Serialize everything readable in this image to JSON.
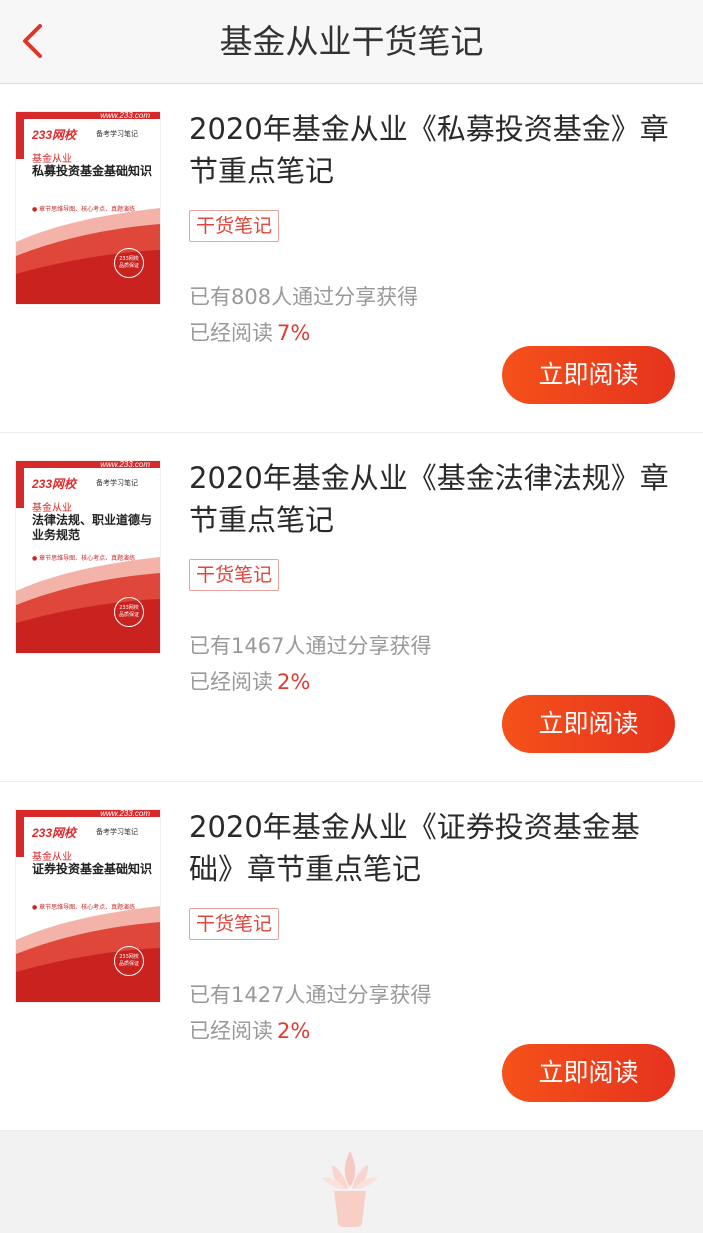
{
  "header": {
    "title": "基金从业干货笔记"
  },
  "colors": {
    "accent": "#e6331e",
    "tag_text": "#e0463b",
    "muted": "#999999"
  },
  "items": [
    {
      "title": "2020年基金从业《私募投资基金》章节重点笔记",
      "tag": "干货笔记",
      "shares": "已有808人通过分享获得",
      "progress_label": "已经阅读",
      "progress": "7%",
      "button": "立即阅读",
      "cover": {
        "url": "www.233.com",
        "brand": "233网校",
        "tagline": "备考学习笔记",
        "subject": "基金从业",
        "book_title": "私募投资基金基础知识",
        "bullets": "● 章节思维导图、核心考点、真题演练"
      }
    },
    {
      "title": "2020年基金从业《基金法律法规》章节重点笔记",
      "tag": "干货笔记",
      "shares": "已有1467人通过分享获得",
      "progress_label": "已经阅读",
      "progress": "2%",
      "button": "立即阅读",
      "cover": {
        "url": "www.233.com",
        "brand": "233网校",
        "tagline": "备考学习笔记",
        "subject": "基金从业",
        "book_title": "法律法规、职业道德与业务规范",
        "bullets": "● 章节思维导图、核心考点、真题演练"
      }
    },
    {
      "title": "2020年基金从业《证券投资基金基础》章节重点笔记",
      "tag": "干货笔记",
      "shares": "已有1427人通过分享获得",
      "progress_label": "已经阅读",
      "progress": "2%",
      "button": "立即阅读",
      "cover": {
        "url": "www.233.com",
        "brand": "233网校",
        "tagline": "备考学习笔记",
        "subject": "基金从业",
        "book_title": "证券投资基金基础知识",
        "bullets": "● 章节思维导图、核心考点、真题演练"
      }
    }
  ]
}
